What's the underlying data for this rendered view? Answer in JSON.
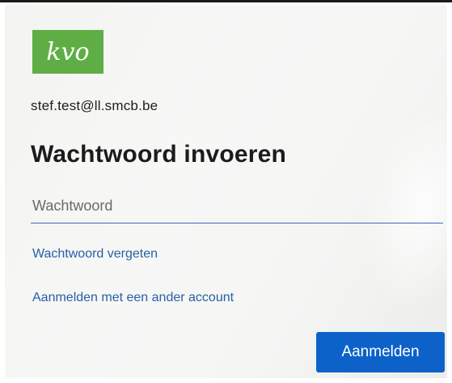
{
  "logo": {
    "text": "kvo",
    "color": "#5fae45"
  },
  "account": {
    "email": "stef.test@ll.smcb.be"
  },
  "page": {
    "title": "Wachtwoord invoeren"
  },
  "password": {
    "placeholder": "Wachtwoord",
    "value": ""
  },
  "links": {
    "forgot_password": "Wachtwoord vergeten",
    "other_account": "Aanmelden met een ander account"
  },
  "actions": {
    "sign_in": "Aanmelden"
  },
  "colors": {
    "accent": "#0d62c9",
    "link": "#275fa8",
    "underline": "#3b6bb8"
  }
}
